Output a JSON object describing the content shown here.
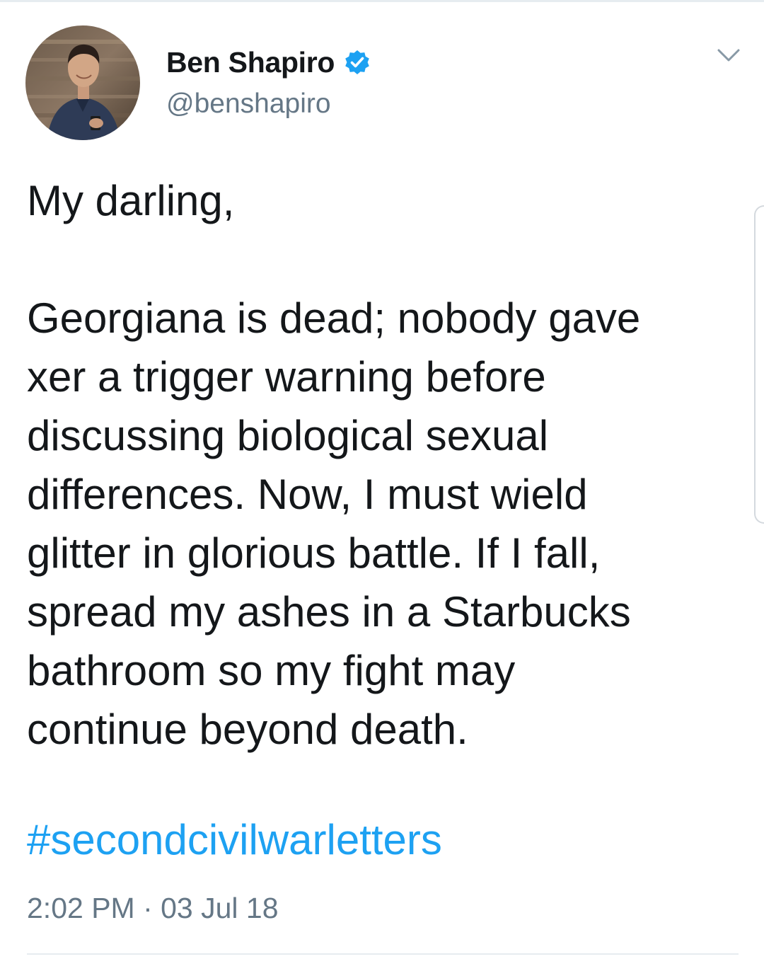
{
  "tweet": {
    "author": {
      "display_name": "Ben Shapiro",
      "handle": "@benshapiro",
      "verified": true,
      "avatar_icon": "avatar-photo"
    },
    "menu_icon": "chevron-down-icon",
    "body": {
      "greeting": "My darling,",
      "lines": [
        "Georgiana is dead; nobody gave",
        "xer a trigger warning before",
        "discussing biological sexual",
        "differences. Now, I must wield",
        "glitter in glorious battle. If I fall,",
        "spread my ashes in a Starbucks",
        "bathroom so my fight may",
        "continue beyond death."
      ]
    },
    "hashtag": "#secondcivilwarletters",
    "timestamp": "2:02 PM · 03 Jul 18"
  },
  "colors": {
    "text": "#14171a",
    "secondary": "#657786",
    "link": "#1da1f2",
    "verified_badge": "#1da1f2",
    "divider": "#e6ecf0"
  }
}
